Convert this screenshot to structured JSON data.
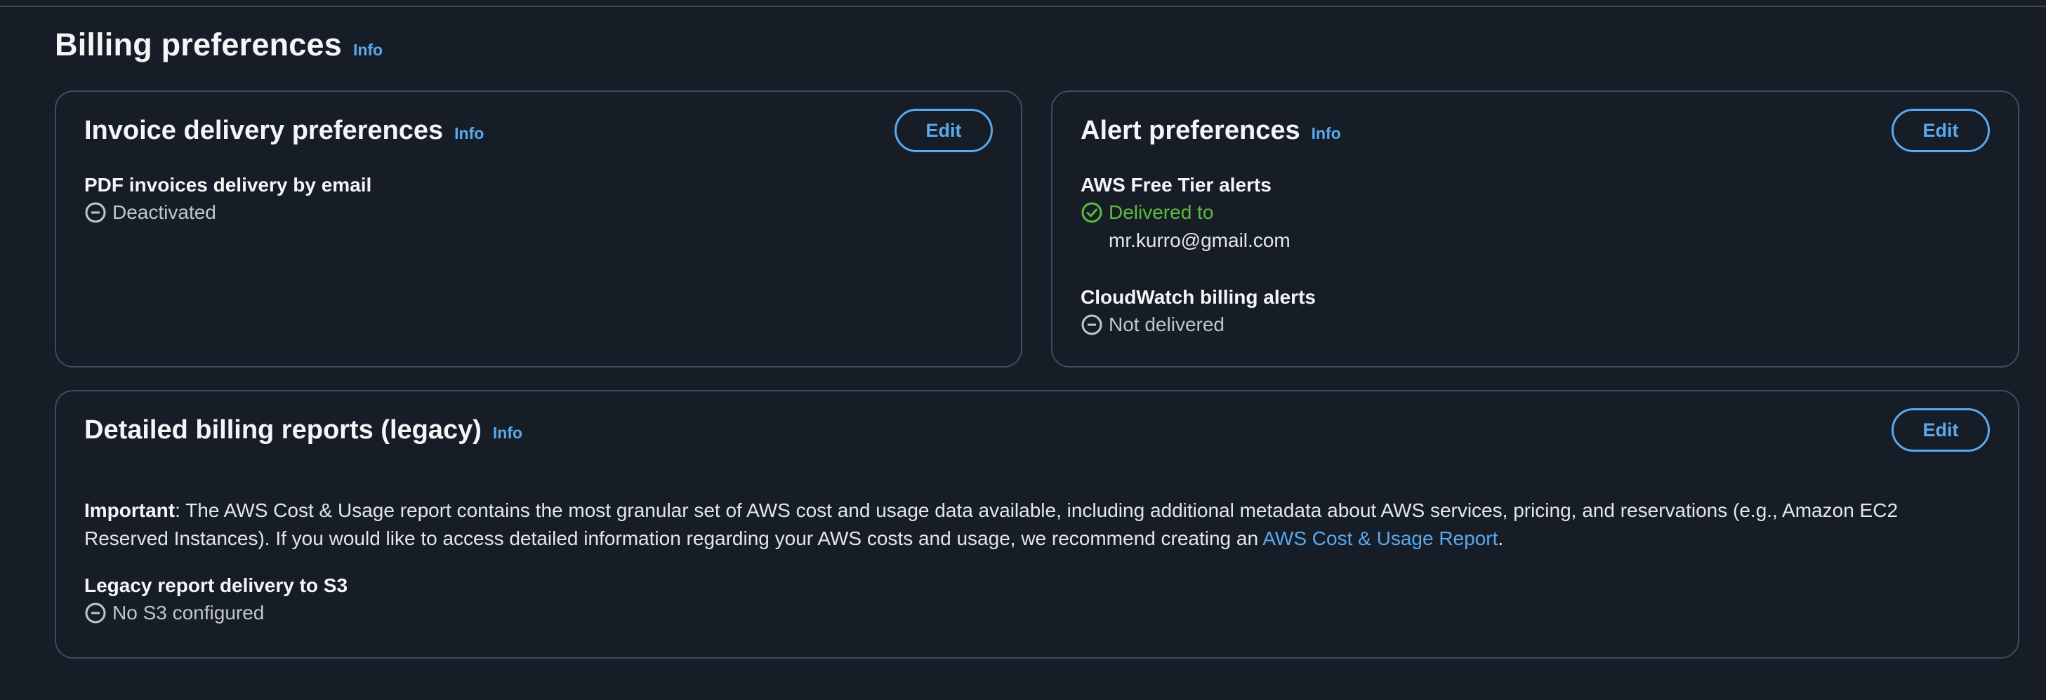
{
  "page": {
    "title": "Billing preferences",
    "info": "Info"
  },
  "invoice": {
    "title": "Invoice delivery preferences",
    "info": "Info",
    "edit": "Edit",
    "pdf_label": "PDF invoices delivery by email",
    "pdf_status": "Deactivated"
  },
  "alerts": {
    "title": "Alert preferences",
    "info": "Info",
    "edit": "Edit",
    "free_tier_label": "AWS Free Tier alerts",
    "free_tier_status": "Delivered to",
    "free_tier_email": "mr.kurro@gmail.com",
    "cloudwatch_label": "CloudWatch billing alerts",
    "cloudwatch_status": "Not delivered"
  },
  "reports": {
    "title": "Detailed billing reports (legacy)",
    "info": "Info",
    "edit": "Edit",
    "important_label": "Important",
    "important_text": ": The AWS Cost & Usage report contains the most granular set of AWS cost and usage data available, including additional metadata about AWS services, pricing, and reservations (e.g., Amazon EC2 Reserved Instances). If you would like to access detailed information regarding your AWS costs and usage, we recommend creating an ",
    "important_link": "AWS Cost & Usage Report",
    "important_end": ".",
    "s3_label": "Legacy report delivery to S3",
    "s3_status": "No S3 configured"
  },
  "colors": {
    "background": "#161d26",
    "accent": "#5aa9ef",
    "success": "#5dbb3e",
    "border": "#414b5b"
  },
  "icons": {
    "deactivated": "minus-circle-icon",
    "delivered": "check-circle-icon"
  }
}
